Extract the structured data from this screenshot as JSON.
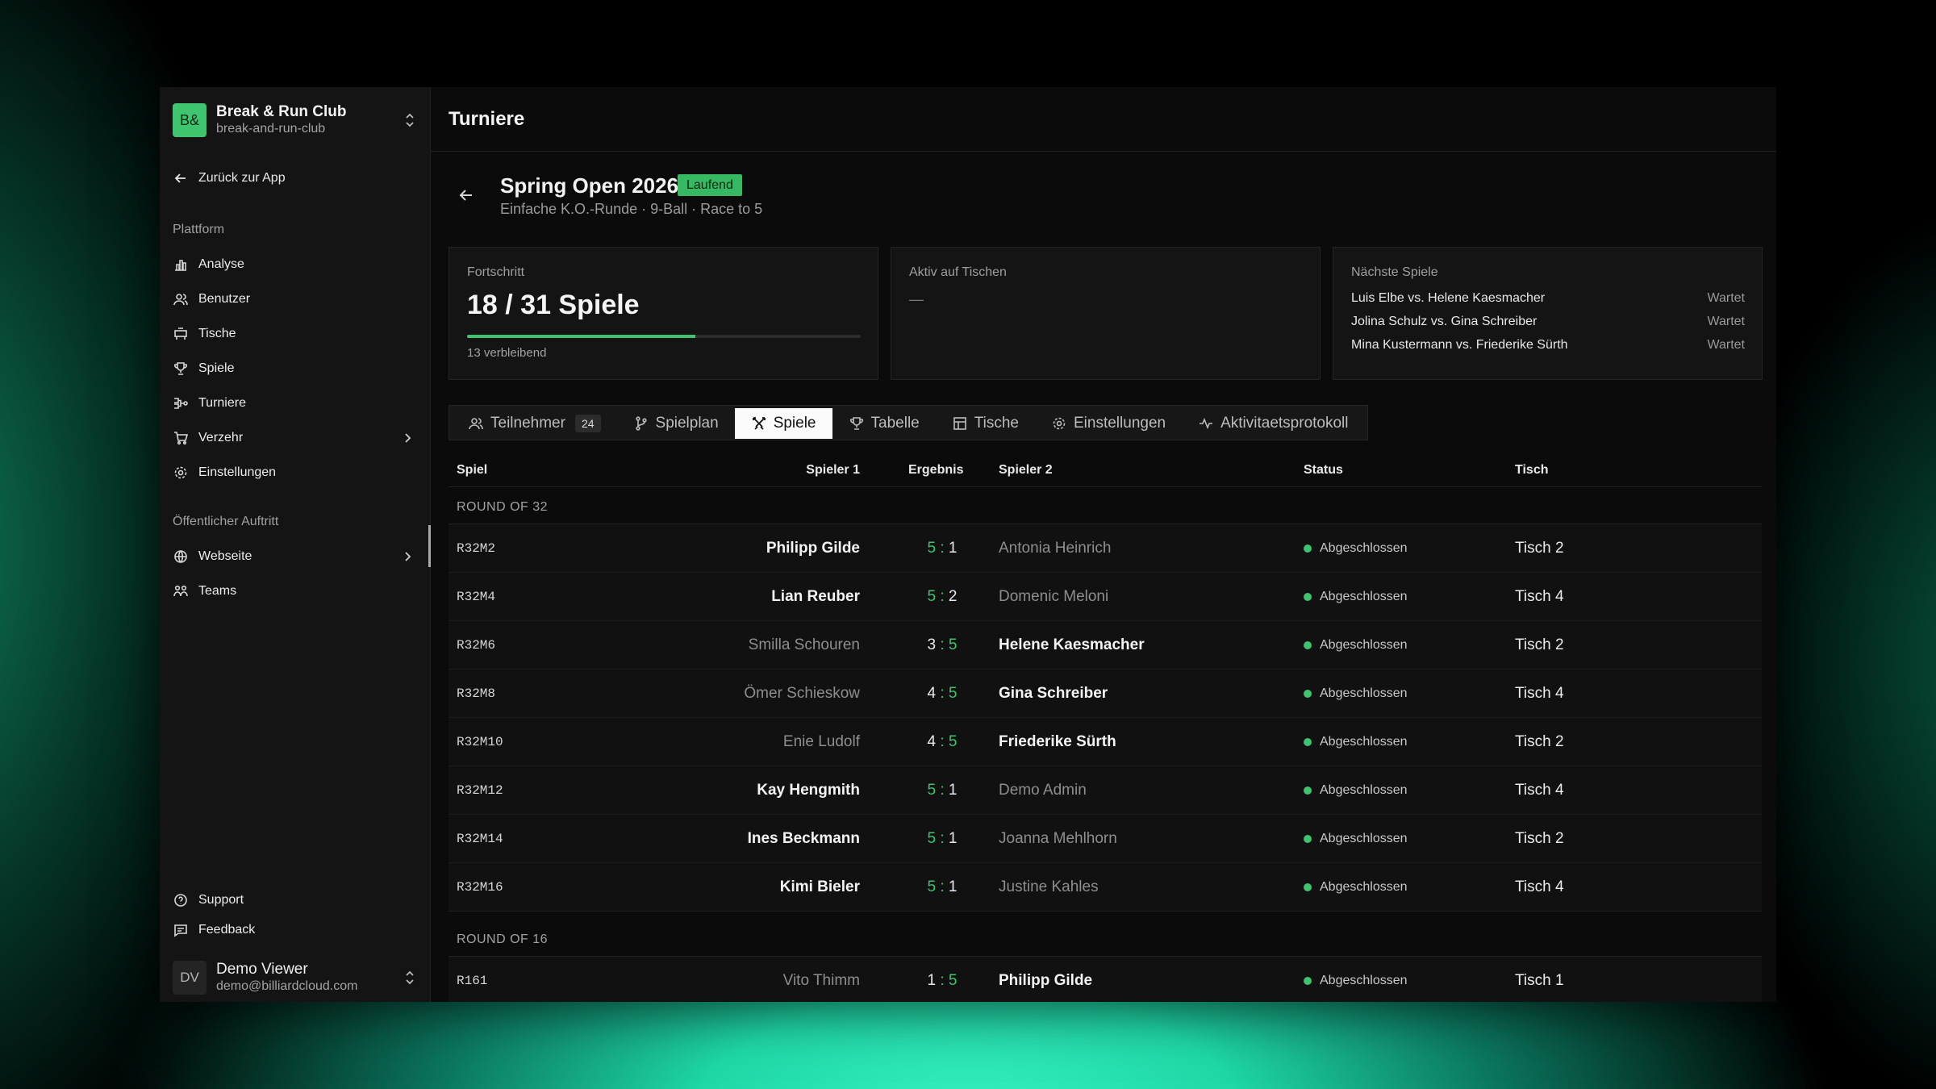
{
  "sidebar": {
    "org": {
      "logo": "B&",
      "name": "Break & Run Club",
      "slug": "break-and-run-club"
    },
    "back_label": "Zurück zur App",
    "platform_label": "Plattform",
    "platform_items": [
      {
        "label": "Analyse",
        "icon": "bar-chart-icon"
      },
      {
        "label": "Benutzer",
        "icon": "users-icon"
      },
      {
        "label": "Tische",
        "icon": "pool-table-icon"
      },
      {
        "label": "Spiele",
        "icon": "trophy-icon"
      },
      {
        "label": "Turniere",
        "icon": "bracket-icon"
      },
      {
        "label": "Verzehr",
        "icon": "cart-icon",
        "has_submenu": true
      },
      {
        "label": "Einstellungen",
        "icon": "gear-icon"
      }
    ],
    "public_label": "Öffentlicher Auftritt",
    "public_items": [
      {
        "label": "Webseite",
        "icon": "globe-icon",
        "has_submenu": true
      },
      {
        "label": "Teams",
        "icon": "teams-icon"
      }
    ],
    "support_label": "Support",
    "feedback_label": "Feedback",
    "user": {
      "initials": "DV",
      "name": "Demo Viewer",
      "email": "demo@billiardcloud.com"
    }
  },
  "header": {
    "title": "Turniere"
  },
  "tournament": {
    "name": "Spring Open 2026",
    "status": "Laufend",
    "subtitle": "Einfache K.O.-Runde · 9-Ball · Race to 5"
  },
  "cards": {
    "progress": {
      "label": "Fortschritt",
      "value": "18 / 31 Spiele",
      "fraction": 0.58,
      "remaining": "13 verbleibend"
    },
    "active": {
      "label": "Aktiv auf Tischen",
      "value": "—"
    },
    "next": {
      "label": "Nächste Spiele",
      "items": [
        {
          "match": "Luis Elbe vs. Helene Kaesmacher",
          "state": "Wartet"
        },
        {
          "match": "Jolina Schulz vs. Gina Schreiber",
          "state": "Wartet"
        },
        {
          "match": "Mina Kustermann vs. Friederike Sürth",
          "state": "Wartet"
        }
      ]
    }
  },
  "tabs": [
    {
      "label": "Teilnehmer",
      "count": "24",
      "icon": "users-icon"
    },
    {
      "label": "Spielplan",
      "icon": "git-branch-icon"
    },
    {
      "label": "Spiele",
      "icon": "swords-icon",
      "active": true
    },
    {
      "label": "Tabelle",
      "icon": "trophy-icon"
    },
    {
      "label": "Tische",
      "icon": "table-grid-icon"
    },
    {
      "label": "Einstellungen",
      "icon": "gear-icon"
    },
    {
      "label": "Aktivitaetsprotokoll",
      "icon": "activity-icon"
    }
  ],
  "table": {
    "headers": {
      "spiel": "Spiel",
      "spieler1": "Spieler 1",
      "ergebnis": "Ergebnis",
      "spieler2": "Spieler 2",
      "status": "Status",
      "tisch": "Tisch"
    },
    "groups": [
      {
        "label": "ROUND OF 32",
        "rows": [
          {
            "code": "R32M2",
            "p1": "Philipp Gilde",
            "s1": "5",
            "s2": "1",
            "p2": "Antonia Heinrich",
            "status": "Abgeschlossen",
            "table": "Tisch 2"
          },
          {
            "code": "R32M4",
            "p1": "Lian Reuber",
            "s1": "5",
            "s2": "2",
            "p2": "Domenic Meloni",
            "status": "Abgeschlossen",
            "table": "Tisch 4"
          },
          {
            "code": "R32M6",
            "p1": "Smilla Schouren",
            "s1": "3",
            "s2": "5",
            "p2": "Helene Kaesmacher",
            "status": "Abgeschlossen",
            "table": "Tisch 2"
          },
          {
            "code": "R32M8",
            "p1": "Ömer Schieskow",
            "s1": "4",
            "s2": "5",
            "p2": "Gina Schreiber",
            "status": "Abgeschlossen",
            "table": "Tisch 4"
          },
          {
            "code": "R32M10",
            "p1": "Enie Ludolf",
            "s1": "4",
            "s2": "5",
            "p2": "Friederike Sürth",
            "status": "Abgeschlossen",
            "table": "Tisch 2"
          },
          {
            "code": "R32M12",
            "p1": "Kay Hengmith",
            "s1": "5",
            "s2": "1",
            "p2": "Demo Admin",
            "status": "Abgeschlossen",
            "table": "Tisch 4"
          },
          {
            "code": "R32M14",
            "p1": "Ines Beckmann",
            "s1": "5",
            "s2": "1",
            "p2": "Joanna Mehlhorn",
            "status": "Abgeschlossen",
            "table": "Tisch 2"
          },
          {
            "code": "R32M16",
            "p1": "Kimi Bieler",
            "s1": "5",
            "s2": "1",
            "p2": "Justine Kahles",
            "status": "Abgeschlossen",
            "table": "Tisch 4"
          }
        ]
      },
      {
        "label": "ROUND OF 16",
        "rows": [
          {
            "code": "R161",
            "p1": "Vito Thimm",
            "s1": "1",
            "s2": "5",
            "p2": "Philipp Gilde",
            "status": "Abgeschlossen",
            "table": "Tisch 1"
          }
        ]
      }
    ]
  },
  "colors": {
    "accent": "#3ec46e",
    "background": "#0b0b0b",
    "sidebar": "#141414"
  }
}
